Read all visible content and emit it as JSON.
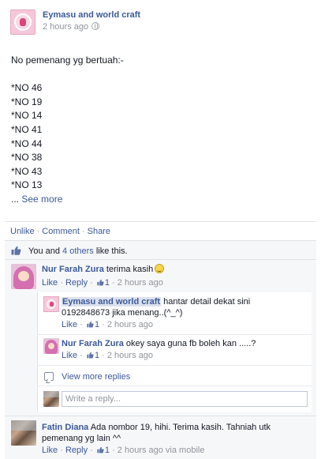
{
  "post": {
    "page_name": "Eymasu and world craft",
    "time": "2 hours ago",
    "privacy_icon": "globe-icon",
    "body_lines": [
      "No pemenang yg bertuah:-",
      "",
      "*NO 46",
      "*NO 19",
      "*NO 14",
      "*NO 41",
      "*NO 44",
      "*NO 38",
      "*NO 43",
      "*NO 13"
    ],
    "ellipsis": "... ",
    "see_more": "See more"
  },
  "actions": {
    "unlike": "Unlike",
    "comment": "Comment",
    "share": "Share",
    "separator": "·"
  },
  "likes": {
    "prefix": "You and ",
    "others": "4 others",
    "suffix": " like this."
  },
  "comments": [
    {
      "author": "Nur Farah Zura",
      "text": "terima kasih",
      "emoticon": "smile-icon",
      "like": "Like",
      "reply": "Reply",
      "like_count": "1",
      "time": "2 hours ago",
      "replies": [
        {
          "author": "Eymasu and world craft",
          "text_line1": "hantar detail dekat sini",
          "text_line2": "0192848673 jika menang..(^_^)",
          "like": "Like",
          "like_count": "1",
          "time": "2 hours ago"
        },
        {
          "author": "Nur Farah Zura",
          "text": "okey saya guna fb boleh kan .....?",
          "like": "Like",
          "like_count": "1",
          "time": "2 hours ago"
        }
      ],
      "view_more_replies": "View more replies",
      "reply_placeholder": "Write a reply..."
    },
    {
      "author": "Fatin Diana",
      "text_line1": "Ada nombor 19, hihi. Terima kasih. Tahniah utk",
      "text_line2": "pemenang yg lain ^^",
      "like": "Like",
      "reply": "Reply",
      "like_count": "1",
      "time": "2 hours ago via mobile"
    }
  ],
  "colors": {
    "link": "#3b5998",
    "meta": "#90949c",
    "feedback_bg": "#f6f7f9",
    "highlight": "#dce1ee"
  }
}
